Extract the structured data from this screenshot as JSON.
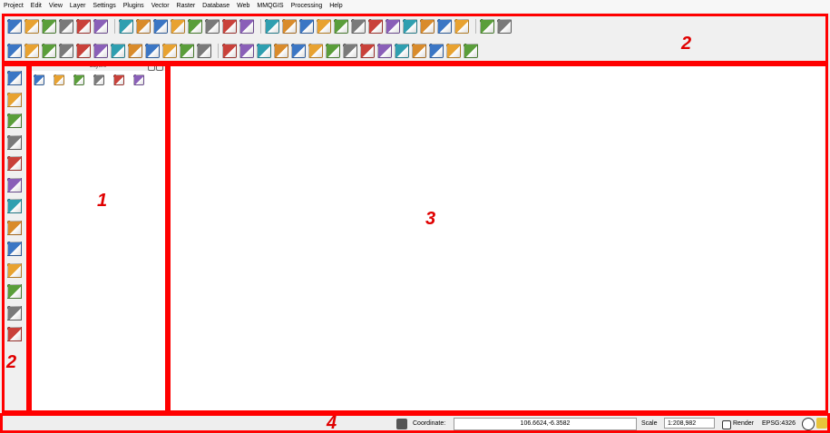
{
  "menu": [
    "Project",
    "Edit",
    "View",
    "Layer",
    "Settings",
    "Plugins",
    "Vector",
    "Raster",
    "Database",
    "Web",
    "MMQGIS",
    "Processing",
    "Help"
  ],
  "toolbar_row1_icons": [
    "new-project-icon",
    "open-project-icon",
    "save-project-icon",
    "save-as-icon",
    "new-print-layout-icon",
    "layout-manager-icon",
    "label-toolbar-icon",
    "layer-labeling-icon",
    "pin-label-icon",
    "show-label-icon",
    "move-label-icon",
    "rotate-label-icon",
    "change-label-icon",
    "label-properties-icon",
    "pointer-touch-icon",
    "pan-icon",
    "pan-to-selection-icon",
    "zoom-in-icon",
    "zoom-out-icon",
    "zoom-actual-icon",
    "zoom-full-icon",
    "zoom-layer-icon",
    "zoom-selection-icon",
    "zoom-last-icon",
    "zoom-next-icon",
    "refresh-icon",
    "plugin-star-icon",
    "plugin-leaf-icon"
  ],
  "toolbar_row2_icons": [
    "identify-icon",
    "measure-icon",
    "select-features-icon",
    "deselect-icon",
    "field-calculator-icon",
    "attribute-table-icon",
    "statistics-icon",
    "measure-line-icon",
    "map-tips-icon",
    "text-annotation-icon",
    "html-annotation-icon",
    "form-annotation-icon",
    "digitize-1-icon",
    "digitize-2-icon",
    "digitize-3-icon",
    "digitize-4-icon",
    "digitize-5-icon",
    "digitize-6-icon",
    "digitize-7-icon",
    "digitize-8-icon",
    "digitize-9-icon",
    "digitize-10-icon",
    "digitize-11-icon",
    "digitize-12-icon",
    "digitize-13-icon",
    "digitize-14-icon",
    "digitize-15-icon"
  ],
  "left_toolbar_icons": [
    "add-vector-layer-icon",
    "add-raster-layer-icon",
    "add-postgis-layer-icon",
    "add-spatialite-layer-icon",
    "add-mssql-layer-icon",
    "add-oracle-layer-icon",
    "add-db2-layer-icon",
    "add-wms-layer-icon",
    "add-wcs-layer-icon",
    "add-wfs-layer-icon",
    "add-delimited-text-icon",
    "new-shapefile-icon",
    "add-virtual-layer-icon"
  ],
  "panel": {
    "title": "Layers",
    "tool_icons": [
      "add-group-icon",
      "manage-visibility-icon",
      "filter-legend-icon",
      "expand-all-icon",
      "collapse-all-icon",
      "remove-layer-icon"
    ]
  },
  "status": {
    "coordinate_label": "Coordinate:",
    "coordinate_value": "106.6624,-6.3582",
    "scale_label": "Scale",
    "scale_value": "1:208,982",
    "render_label": "Render",
    "crs": "EPSG:4326"
  },
  "annotations": {
    "panel_number": "1",
    "toolbar_top_number": "2",
    "toolbar_left_number": "2",
    "canvas_number": "3",
    "status_number": "4"
  }
}
